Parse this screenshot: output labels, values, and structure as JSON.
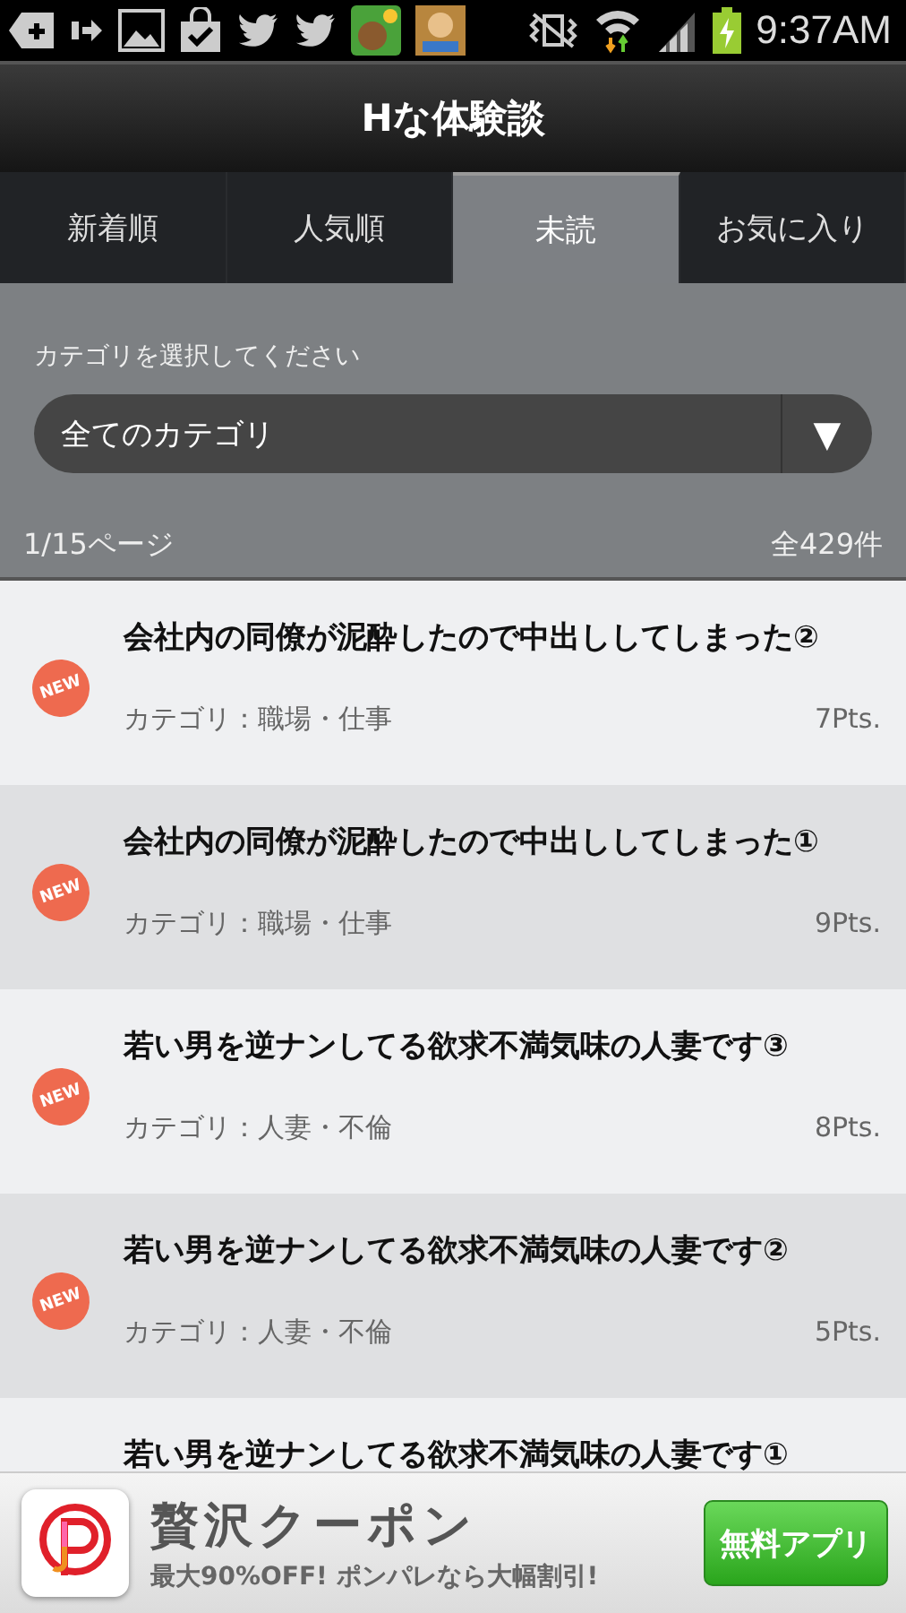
{
  "status_bar": {
    "time": "9:37AM"
  },
  "header": {
    "title": "Hな体験談"
  },
  "tabs": [
    {
      "label": "新着順",
      "selected": false
    },
    {
      "label": "人気順",
      "selected": false
    },
    {
      "label": "未読",
      "selected": true
    },
    {
      "label": "お気に入り",
      "selected": false
    }
  ],
  "filter": {
    "label": "カテゴリを選択してください",
    "dropdown": {
      "value": "全てのカテゴリ",
      "arrow": "▼"
    },
    "page": "1/15ページ",
    "total": "全429件"
  },
  "stories": [
    {
      "badge": "NEW",
      "title": "会社内の同僚が泥酔したので中出ししてしまった②",
      "category": "カテゴリ：職場・仕事",
      "points": "7Pts."
    },
    {
      "badge": "NEW",
      "title": "会社内の同僚が泥酔したので中出ししてしまった①",
      "category": "カテゴリ：職場・仕事",
      "points": "9Pts."
    },
    {
      "badge": "NEW",
      "title": "若い男を逆ナンしてる欲求不満気味の人妻です③",
      "category": "カテゴリ：人妻・不倫",
      "points": "8Pts."
    },
    {
      "badge": "NEW",
      "title": "若い男を逆ナンしてる欲求不満気味の人妻です②",
      "category": "カテゴリ：人妻・不倫",
      "points": "5Pts."
    },
    {
      "title": "若い男を逆ナンしてる欲求不満気味の人妻です①"
    }
  ],
  "ad": {
    "title": "贅沢クーポン",
    "subtitle": "最大90%OFF! ポンパレなら大幅割引!",
    "button": "無料アプリ"
  }
}
